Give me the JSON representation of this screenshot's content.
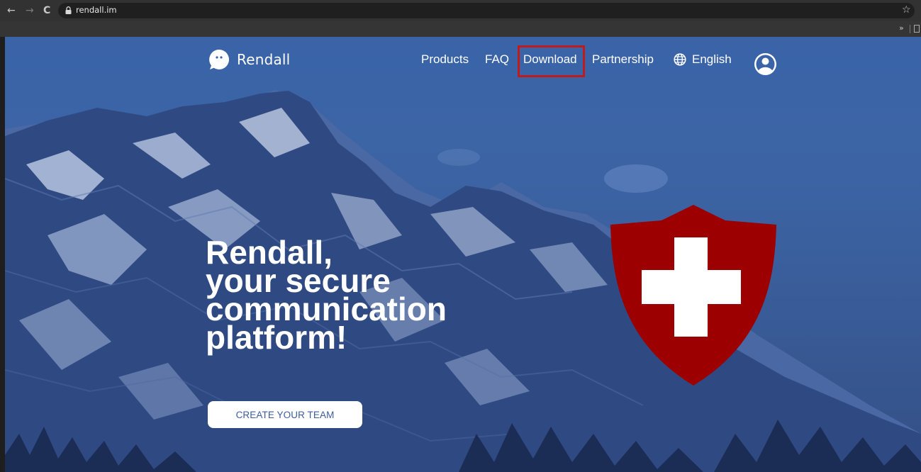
{
  "browser": {
    "url": "rendall.im",
    "back_glyph": "←",
    "forward_glyph": "→",
    "reload_glyph": "C",
    "bookmark_star": "☆",
    "bookmarks_more": "»"
  },
  "site": {
    "logo_text": "Rendall",
    "nav": {
      "products": "Products",
      "faq": "FAQ",
      "download": "Download",
      "partnership": "Partnership",
      "language": "English"
    },
    "headline": [
      "Rendall,",
      "your secure",
      "communication",
      "platform!"
    ],
    "cta_label": "CREATE YOUR TEAM"
  },
  "colors": {
    "hero_blue": "#3a63a8",
    "shield_red": "#9c0000",
    "highlight_red": "#c01a1a",
    "cta_text": "#3d5d9e"
  },
  "icons": [
    "lock-icon",
    "star-icon",
    "logo-bubble-icon",
    "globe-icon",
    "user-account-icon",
    "swiss-shield-icon"
  ]
}
